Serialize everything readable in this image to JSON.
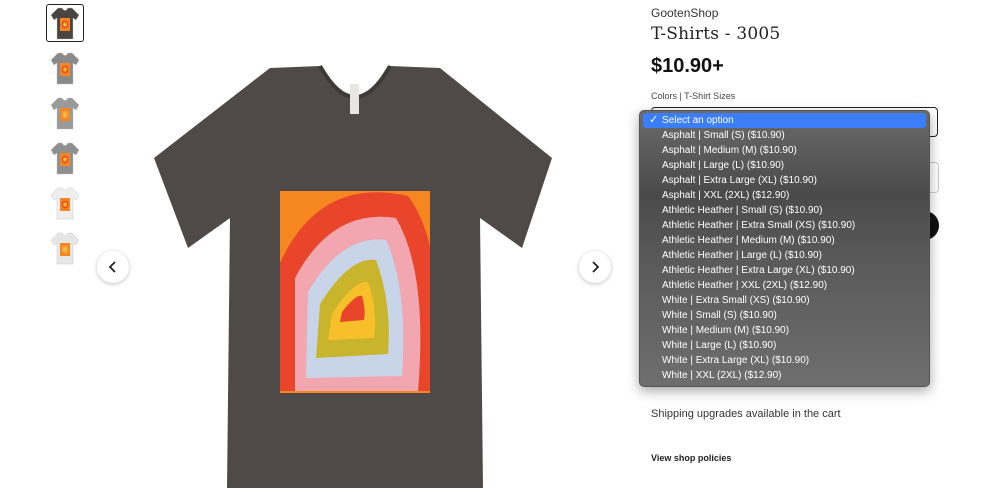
{
  "gallery": {
    "thumbnails": [
      {
        "name": "thumb-1",
        "shirt_color": "#4a4543",
        "print_color": "#e8502a"
      },
      {
        "name": "thumb-2",
        "shirt_color": "#8a8a8a",
        "print_color": "#e8502a"
      },
      {
        "name": "thumb-3",
        "shirt_color": "#9a9a9a",
        "print_color": "#e8a050"
      },
      {
        "name": "thumb-4",
        "shirt_color": "#8f8f8f",
        "print_color": "#e8502a"
      },
      {
        "name": "thumb-5",
        "shirt_color": "#eeeeee",
        "print_color": "#e8502a"
      },
      {
        "name": "thumb-6",
        "shirt_color": "#e6e6e6",
        "print_color": "#e8a050"
      }
    ],
    "main_shirt_color": "#4f4a47",
    "tag_text": "CANVAS"
  },
  "product": {
    "shop_name": "GootenShop",
    "title": "T-Shirts - 3005",
    "price": "$10.90+",
    "select_label": "Colors | T-Shirt Sizes"
  },
  "dropdown": {
    "selected_index": 0,
    "options": [
      "Select an option",
      "Asphalt | Small (S) ($10.90)",
      "Asphalt | Medium (M) ($10.90)",
      "Asphalt | Large (L) ($10.90)",
      "Asphalt | Extra Large (XL) ($10.90)",
      "Asphalt | XXL (2XL) ($12.90)",
      "Athletic Heather | Small (S) ($10.90)",
      "Athletic Heather | Extra Small (XS) ($10.90)",
      "Athletic Heather | Medium (M) ($10.90)",
      "Athletic Heather | Large (L) ($10.90)",
      "Athletic Heather | Extra Large (XL) ($10.90)",
      "Athletic Heather | XXL (2XL) ($12.90)",
      "White | Extra Small (XS) ($10.90)",
      "White | Small (S) ($10.90)",
      "White | Medium (M) ($10.90)",
      "White | Large (L) ($10.90)",
      "White | Extra Large (XL) ($10.90)",
      "White | XXL (2XL) ($12.90)"
    ],
    "check_glyph": "✓",
    "highlight_color": "#3b7ef7"
  },
  "info": {
    "shipping": "Shipping upgrades available in the cart",
    "policies_link": "View shop policies"
  },
  "icons": {
    "prev": "chevron-left-icon",
    "next": "chevron-right-icon"
  }
}
